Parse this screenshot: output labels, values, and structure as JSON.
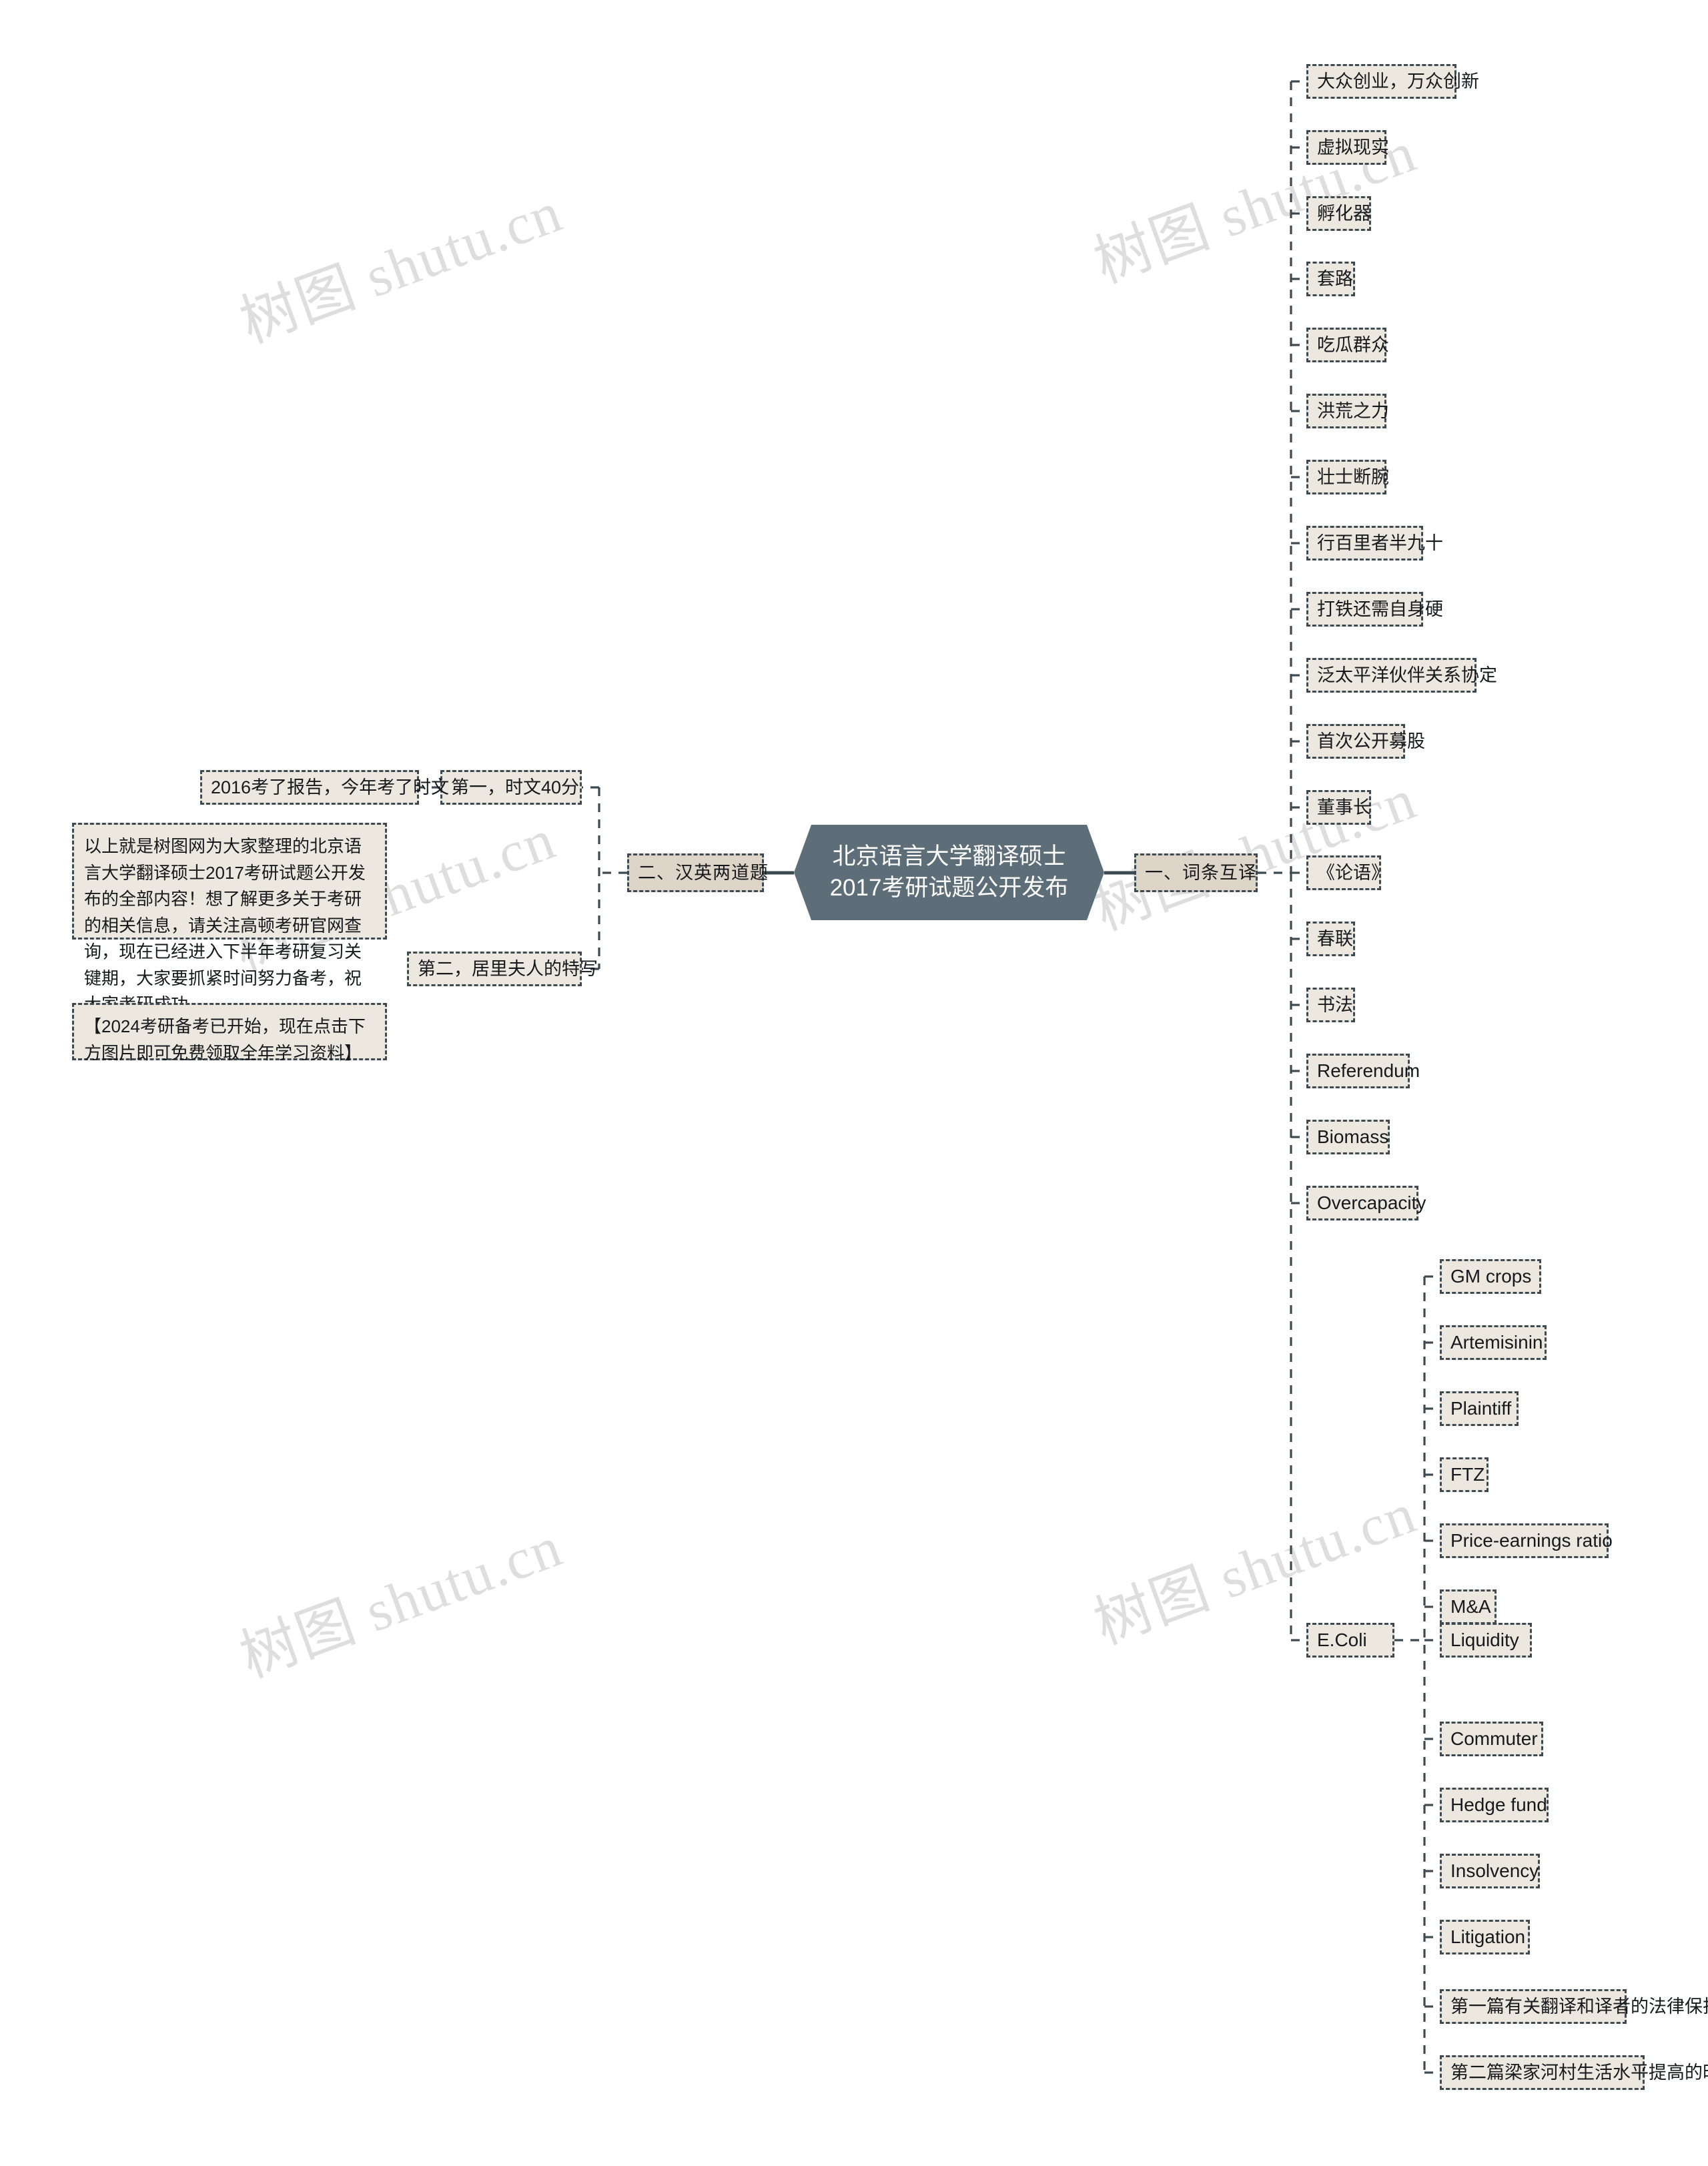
{
  "watermark": {
    "text": "树图 shutu.cn",
    "color": "#dedede"
  },
  "theme": {
    "center_fill": "#5d6e78",
    "center_text": "#ffffff",
    "node_fill": "#ece7df",
    "branch_fill": "#ddd5c8",
    "border": "#3d4a52",
    "page_background": "#ffffff"
  },
  "center": {
    "title": "北京语言大学翻译硕士2017考研试题公开发布"
  },
  "branches": {
    "right": {
      "label": "一、词条互译"
    },
    "left": {
      "label": "二、汉英两道题"
    }
  },
  "right_items": [
    {
      "label": "大众创业，万众创新"
    },
    {
      "label": "虚拟现实"
    },
    {
      "label": "孵化器"
    },
    {
      "label": "套路"
    },
    {
      "label": "吃瓜群众"
    },
    {
      "label": "洪荒之力"
    },
    {
      "label": "壮士断腕"
    },
    {
      "label": "行百里者半九十"
    },
    {
      "label": "打铁还需自身硬"
    },
    {
      "label": "泛太平洋伙伴关系协定"
    },
    {
      "label": "首次公开募股"
    },
    {
      "label": "董事长"
    },
    {
      "label": "《论语》"
    },
    {
      "label": "春联"
    },
    {
      "label": "书法"
    },
    {
      "label": "Referendum"
    },
    {
      "label": "Biomass"
    },
    {
      "label": "Overcapacity"
    }
  ],
  "ecoli": {
    "label": "E.Coli"
  },
  "ecoli_items": [
    {
      "label": "GM crops"
    },
    {
      "label": "Artemisinin"
    },
    {
      "label": "Plaintiff"
    },
    {
      "label": "FTZ"
    },
    {
      "label": "Price-earnings ratio"
    },
    {
      "label": "M&A"
    },
    {
      "label": "Liquidity"
    },
    {
      "label": "Commuter"
    },
    {
      "label": "Hedge fund"
    },
    {
      "label": "Insolvency"
    },
    {
      "label": "Litigation"
    },
    {
      "label": "第一篇有关翻译和译者的法律保护"
    },
    {
      "label": "第二篇梁家河村生活水平提高的时文"
    }
  ],
  "left_items": [
    {
      "label": "第一，时文40分"
    },
    {
      "label": "第二，居里夫人的特写"
    }
  ],
  "left_sub": {
    "label": "2016考了报告，今年考了时文"
  },
  "notes": {
    "summary": "以上就是树图网为大家整理的北京语言大学翻译硕士2017考研试题公开发布的全部内容！想了解更多关于考研的相关信息，请关注高顿考研官网查询，现在已经进入下半年考研复习关键期，大家要抓紧时间努力备考，祝大家考研成功。",
    "promo": "【2024考研备考已开始，现在点击下方图片即可免费领取全年学习资料】"
  }
}
